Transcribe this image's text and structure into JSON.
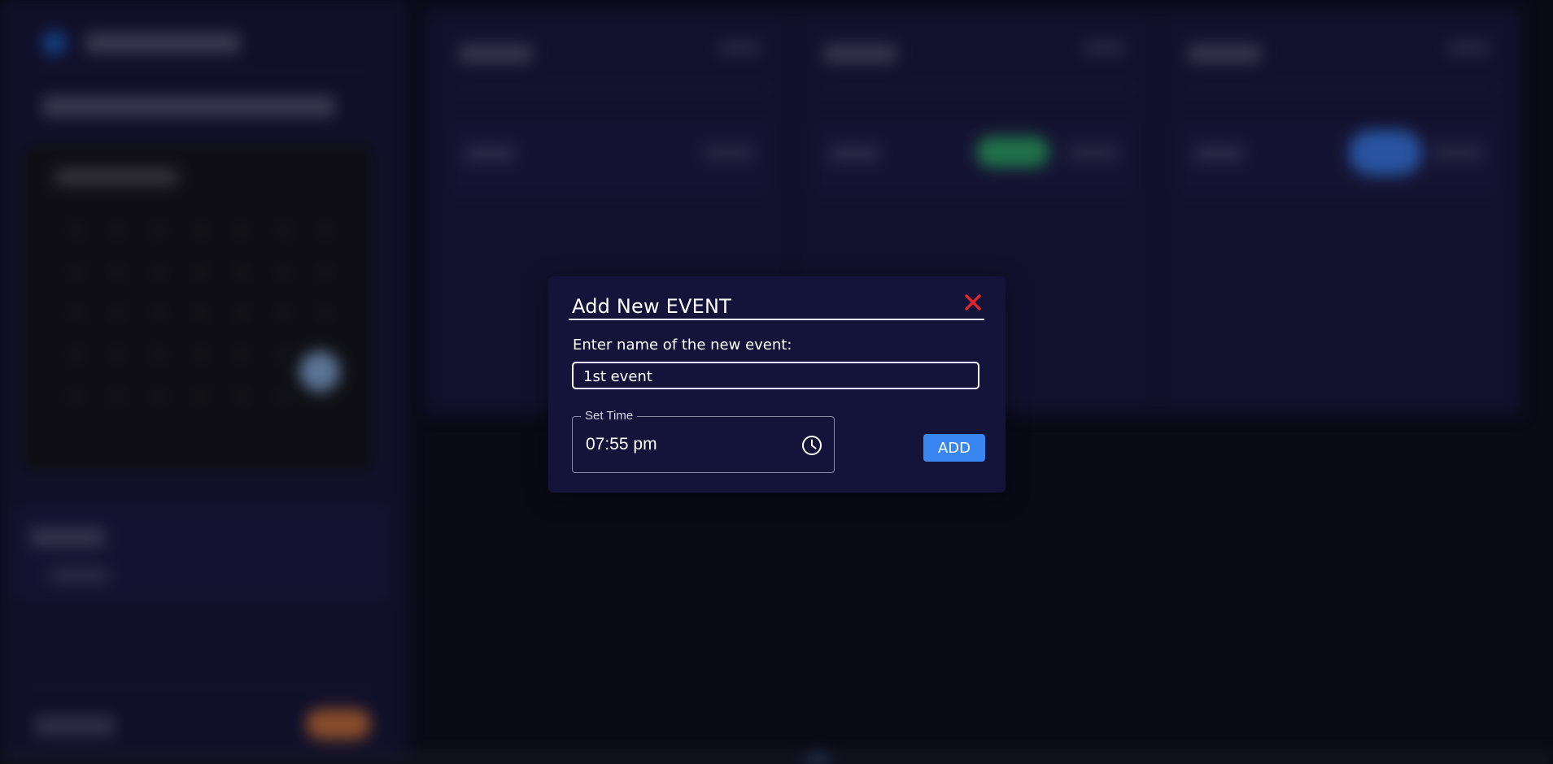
{
  "modal": {
    "title": "Add New EVENT",
    "close_icon": "close-icon",
    "name_label": "Enter name of the new event:",
    "name_value": "1st event",
    "time_legend": "Set Time",
    "time_value": "07:55 pm",
    "clock_icon": "clock-icon",
    "add_label": "ADD"
  },
  "colors": {
    "accent": "#3a86f0",
    "close": "#e0262c",
    "modal_bg": "#14133a",
    "page_bg": "#0c0c1a",
    "status_green": "#2fb36a",
    "status_blue": "#3b82f6",
    "sidebar_orange": "#d7773a"
  }
}
